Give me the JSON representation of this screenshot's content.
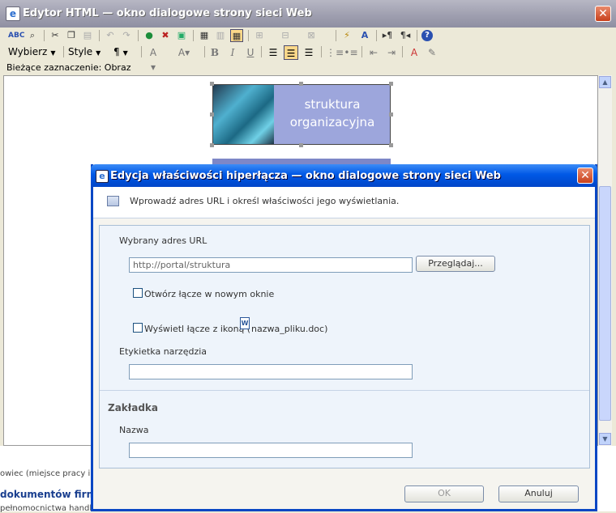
{
  "outer_window": {
    "title": "Edytor HTML — okno dialogowe strony sieci Web",
    "close_glyph": "✕"
  },
  "toolbar2": {
    "select_label": "Wybierz",
    "style_label": "Style",
    "paragraph_glyph": "¶"
  },
  "status_bar": {
    "current_selection": "Bieżące zaznaczenie: Obraz"
  },
  "editor_content": {
    "image_caption_line1": "struktura",
    "image_caption_line2": "organizacyjna"
  },
  "background_page": {
    "line1": "owiec (miejsce pracy ino",
    "line2": "dokumentów firmo",
    "line3": "pełnomocnictwa handlo"
  },
  "dialog": {
    "title": "Edycja właściwości hiperłącza — okno dialogowe strony sieci Web",
    "close_glyph": "✕",
    "instruction": "Wprowadź adres URL i określ właściwości jego wyświetlania.",
    "url_section_label": "Wybrany adres URL",
    "url_value": "http://portal/struktura",
    "browse_button": "Przeglądaj...",
    "new_window_label": "Otwórz łącze w nowym oknie",
    "show_icon_label_prefix": "Wyświetl łącze z ikoną (",
    "show_icon_filename": "nazwa_pliku.doc)",
    "tooltip_label": "Etykietka narzędzia",
    "tooltip_value": "",
    "bookmark_heading": "Zakładka",
    "name_label": "Nazwa",
    "name_value": "",
    "ok_button": "OK",
    "cancel_button": "Anuluj"
  }
}
